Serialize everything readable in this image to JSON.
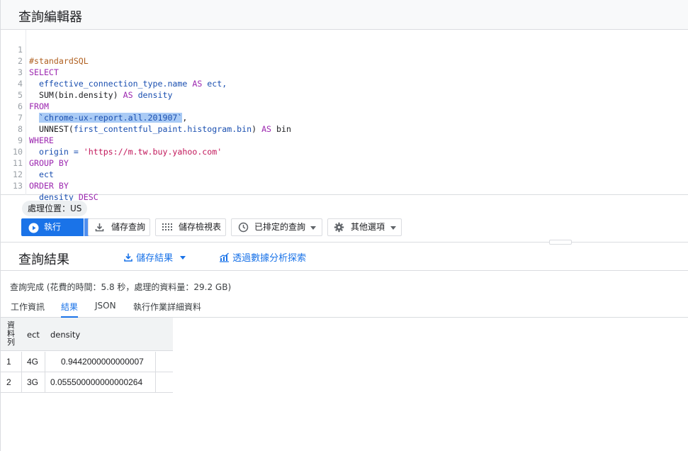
{
  "editor": {
    "title": "查詢編輯器",
    "lines": [
      {
        "n": "1"
      },
      {
        "n": "2"
      },
      {
        "n": "3"
      },
      {
        "n": "4"
      },
      {
        "n": "5"
      },
      {
        "n": "6"
      },
      {
        "n": "7"
      },
      {
        "n": "8"
      },
      {
        "n": "9"
      },
      {
        "n": "10"
      },
      {
        "n": "11"
      },
      {
        "n": "12"
      },
      {
        "n": "13"
      }
    ],
    "code": {
      "l1": "#standardSQL",
      "l2": "SELECT",
      "l3_a": "  effective_connection_type.name ",
      "l3_kw": "AS",
      "l3_b": " ect,",
      "l4_a": "  SUM(bin.density) ",
      "l4_kw": "AS",
      "l4_b": " density",
      "l5": "FROM",
      "l6_hl": "`chrome-ux-report.all.201907`",
      "l6_b": ",",
      "l7_a": "  UNNEST(",
      "l7_id": "first_contentful_paint.histogram.bin",
      "l7_b": ") ",
      "l7_kw": "AS",
      "l7_c": " bin",
      "l8": "WHERE",
      "l9_a": "  origin = ",
      "l9_str": "'https://m.tw.buy.yahoo.com'",
      "l10": "GROUP BY",
      "l11": "  ect",
      "l12": "ORDER BY",
      "l13_a": "  density ",
      "l13_kw": "DESC"
    }
  },
  "location_chip": "處理位置：US",
  "toolbar": {
    "run_label": "執行",
    "save_query_label": "儲存查詢",
    "save_view_label": "儲存檢視表",
    "scheduled_label": "已排定的查詢",
    "more_label": "其他選項"
  },
  "results": {
    "title": "查詢結果",
    "save_results_label": "儲存結果",
    "explore_label": "透過數據分析探索",
    "status": "查詢完成 (花費的時間：5.8 秒，處理的資料量：29.2 GB)",
    "tabs": [
      "工作資訊",
      "結果",
      "JSON",
      "執行作業詳細資料"
    ],
    "active_tab": "結果",
    "columns": [
      "資料列",
      "ect",
      "density"
    ],
    "rows": [
      {
        "num": "1",
        "ect": "4G",
        "density": "0.9442000000000007"
      },
      {
        "num": "2",
        "ect": "3G",
        "density": "0.055500000000000264"
      }
    ]
  },
  "colors": {
    "accent": "#1a73e8",
    "keyword": "#9c27b0",
    "identifier": "#1a4fb0",
    "string": "#c2185b",
    "comment": "#b06020"
  }
}
